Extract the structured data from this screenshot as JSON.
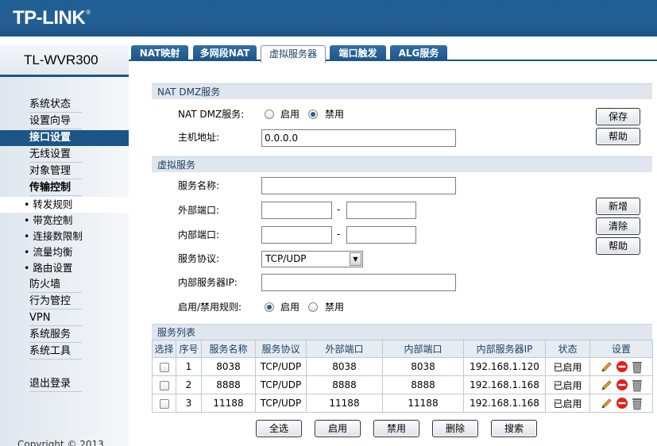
{
  "brand": {
    "logo": "TP-LINK",
    "reg": "®",
    "model": "TL-WVR300"
  },
  "tabs": [
    {
      "label": "NAT映射"
    },
    {
      "label": "多网段NAT"
    },
    {
      "label": "虚拟服务器"
    },
    {
      "label": "端口触发"
    },
    {
      "label": "ALG服务"
    }
  ],
  "sidebar": {
    "items": [
      {
        "label": "系统状态"
      },
      {
        "label": "设置向导"
      },
      {
        "label": "接口设置"
      },
      {
        "label": "无线设置"
      },
      {
        "label": "对象管理"
      },
      {
        "label": "传输控制"
      },
      {
        "label": "• 转发规则"
      },
      {
        "label": "• 带宽控制"
      },
      {
        "label": "• 连接数限制"
      },
      {
        "label": "• 流量均衡"
      },
      {
        "label": "• 路由设置"
      },
      {
        "label": "防火墙"
      },
      {
        "label": "行为管控"
      },
      {
        "label": "VPN"
      },
      {
        "label": "系统服务"
      },
      {
        "label": "系统工具"
      },
      {
        "label": "退出登录"
      }
    ],
    "copyright": "Copyright © 2013"
  },
  "dmz": {
    "header": "NAT DMZ服务",
    "service_label": "NAT DMZ服务:",
    "enable_label": "启用",
    "disable_label": "禁用",
    "selected": "disable",
    "host_label": "主机地址:",
    "host_value": "0.0.0.0",
    "save_button": "保存",
    "help_button": "帮助"
  },
  "virtual_server": {
    "header": "虚拟服务",
    "name_label": "服务名称:",
    "name_value": "",
    "ext_port_label": "外部端口:",
    "int_port_label": "内部端口:",
    "range_sep": "-",
    "protocol_label": "服务协议:",
    "protocol_value": "TCP/UDP",
    "server_ip_label": "内部服务器IP:",
    "server_ip_value": "",
    "rule_label": "启用/禁用规则:",
    "enable_label": "启用",
    "disable_label": "禁用",
    "selected": "enable",
    "add_button": "新增",
    "clear_button": "清除",
    "help_button": "帮助"
  },
  "service_list": {
    "header": "服务列表",
    "columns": [
      "选择",
      "序号",
      "服务名称",
      "服务协议",
      "外部端口",
      "内部端口",
      "内部服务器IP",
      "状态",
      "设置"
    ],
    "rows": [
      {
        "no": "1",
        "name": "8038",
        "protocol": "TCP/UDP",
        "ext_port": "8038",
        "int_port": "8038",
        "ip": "192.168.1.120",
        "status": "已启用"
      },
      {
        "no": "2",
        "name": "8888",
        "protocol": "TCP/UDP",
        "ext_port": "8888",
        "int_port": "8888",
        "ip": "192.168.1.168",
        "status": "已启用"
      },
      {
        "no": "3",
        "name": "11188",
        "protocol": "TCP/UDP",
        "ext_port": "11188",
        "int_port": "11188",
        "ip": "192.168.1.168",
        "status": "已启用"
      }
    ],
    "buttons": {
      "select_all": "全选",
      "enable": "启用",
      "disable": "禁用",
      "delete": "删除",
      "search": "搜索"
    }
  },
  "colors": {
    "brand_blue": "#1d5486",
    "section_bg": "#dfe6ee"
  }
}
